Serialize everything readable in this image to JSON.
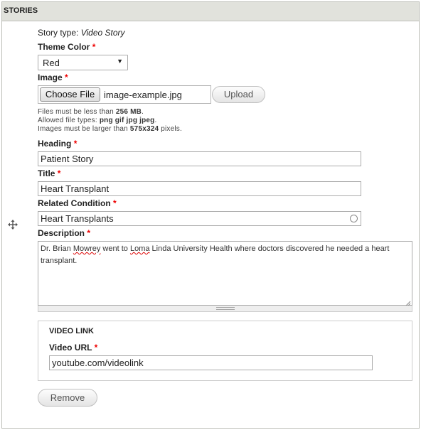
{
  "panel": {
    "title": "STORIES"
  },
  "story_type": {
    "label": "Story type:",
    "value": "Video Story"
  },
  "theme_color": {
    "label": "Theme Color",
    "required": "*",
    "selected": "Red",
    "arrow": "▼"
  },
  "image": {
    "label": "Image",
    "required": "*",
    "choose_label": "Choose File",
    "filename": "image-example.jpg",
    "upload_label": "Upload",
    "help_size_prefix": "Files must be less than ",
    "help_size_value": "256 MB",
    "help_size_suffix": ".",
    "help_types_prefix": "Allowed file types: ",
    "help_types_value": "png gif jpg jpeg",
    "help_types_suffix": ".",
    "help_dims_prefix": "Images must be larger than ",
    "help_dims_value": "575x324",
    "help_dims_suffix": " pixels."
  },
  "heading": {
    "label": "Heading",
    "required": "*",
    "value": "Patient Story"
  },
  "title": {
    "label": "Title",
    "required": "*",
    "value": "Heart Transplant"
  },
  "related_condition": {
    "label": "Related Condition",
    "required": "*",
    "value": "Heart Transplants"
  },
  "description": {
    "label": "Description",
    "required": "*",
    "text_1": "Dr. Brian ",
    "text_2": "Mowrey",
    "text_3": " went to ",
    "text_4": "Loma",
    "text_5": " Linda University Health where doctors discovered he needed a heart",
    "text_6": "transplant."
  },
  "video_link": {
    "legend": "VIDEO LINK",
    "url_label": "Video URL",
    "required": "*",
    "url_value": "youtube.com/videolink"
  },
  "remove_label": "Remove",
  "colors": {
    "required": "#ee0000",
    "header_bg": "#e1e2dc",
    "border": "#bebfb9"
  }
}
